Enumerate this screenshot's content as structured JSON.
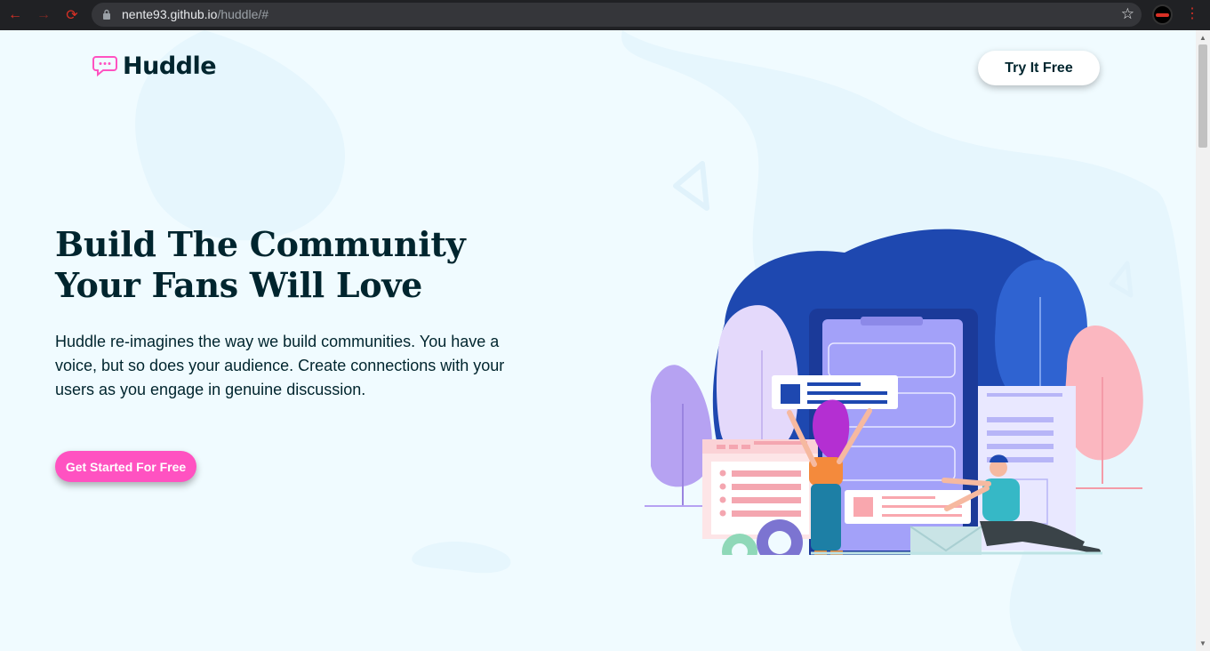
{
  "browser": {
    "url_host": "nente93.github.io",
    "url_path": "/huddle/#",
    "nav_back_icon": "back-arrow-icon",
    "nav_forward_icon": "forward-arrow-icon",
    "reload_icon": "reload-icon",
    "bookmark_icon": "star-icon",
    "menu_icon": "more-vert-icon"
  },
  "header": {
    "logo_text": "Huddle",
    "try_button": "Try It Free"
  },
  "hero": {
    "title_line1": "Build The Community",
    "title_line2": "Your Fans Will Love",
    "description": "Huddle re-imagines the way we build communities. You have a voice, but so does your audience. Create connections with your users as you engage in genuine discussion.",
    "cta_button": "Get Started For Free"
  },
  "colors": {
    "background": "#f0fbff",
    "text_dark": "#00252e",
    "accent_pink": "#ff52c1",
    "illustration_blue": "#1e48b0",
    "illustration_purple": "#a3a1f9"
  }
}
